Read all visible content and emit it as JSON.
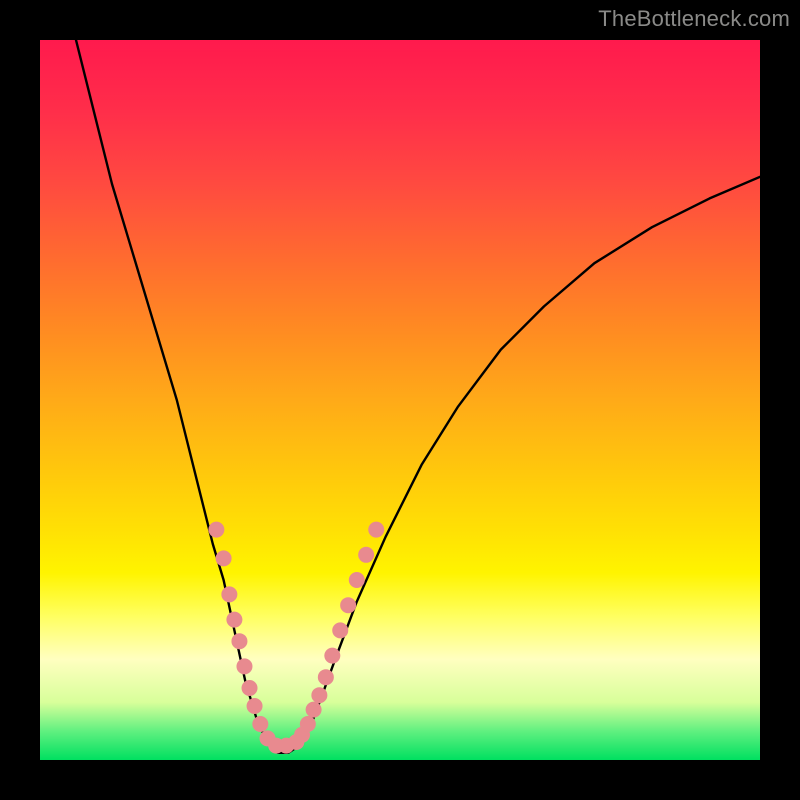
{
  "watermark": {
    "text": "TheBottleneck.com"
  },
  "chart_data": {
    "type": "line",
    "title": "",
    "xlabel": "",
    "ylabel": "",
    "xlim": [
      0,
      100
    ],
    "ylim": [
      0,
      100
    ],
    "grid": false,
    "legend": false,
    "annotations": [],
    "background": "vertical gradient red→yellow→green on black frame",
    "curve_points": [
      {
        "x": 5.0,
        "y": 100.0
      },
      {
        "x": 7.0,
        "y": 92.0
      },
      {
        "x": 10.0,
        "y": 80.0
      },
      {
        "x": 13.0,
        "y": 70.0
      },
      {
        "x": 16.0,
        "y": 60.0
      },
      {
        "x": 19.0,
        "y": 50.0
      },
      {
        "x": 22.0,
        "y": 38.0
      },
      {
        "x": 24.0,
        "y": 30.0
      },
      {
        "x": 25.5,
        "y": 25.0
      },
      {
        "x": 27.0,
        "y": 18.0
      },
      {
        "x": 28.5,
        "y": 11.0
      },
      {
        "x": 30.0,
        "y": 6.0
      },
      {
        "x": 31.5,
        "y": 2.5
      },
      {
        "x": 33.0,
        "y": 1.0
      },
      {
        "x": 34.5,
        "y": 1.0
      },
      {
        "x": 36.0,
        "y": 2.0
      },
      {
        "x": 37.5,
        "y": 4.5
      },
      {
        "x": 39.0,
        "y": 8.5
      },
      {
        "x": 41.0,
        "y": 14.0
      },
      {
        "x": 44.0,
        "y": 22.0
      },
      {
        "x": 48.0,
        "y": 31.0
      },
      {
        "x": 53.0,
        "y": 41.0
      },
      {
        "x": 58.0,
        "y": 49.0
      },
      {
        "x": 64.0,
        "y": 57.0
      },
      {
        "x": 70.0,
        "y": 63.0
      },
      {
        "x": 77.0,
        "y": 69.0
      },
      {
        "x": 85.0,
        "y": 74.0
      },
      {
        "x": 93.0,
        "y": 78.0
      },
      {
        "x": 100.0,
        "y": 81.0
      }
    ],
    "marker_points": [
      {
        "x": 24.5,
        "y": 32.0
      },
      {
        "x": 25.5,
        "y": 28.0
      },
      {
        "x": 26.3,
        "y": 23.0
      },
      {
        "x": 27.0,
        "y": 19.5
      },
      {
        "x": 27.7,
        "y": 16.5
      },
      {
        "x": 28.4,
        "y": 13.0
      },
      {
        "x": 29.1,
        "y": 10.0
      },
      {
        "x": 29.8,
        "y": 7.5
      },
      {
        "x": 30.6,
        "y": 5.0
      },
      {
        "x": 31.6,
        "y": 3.0
      },
      {
        "x": 32.8,
        "y": 2.0
      },
      {
        "x": 34.2,
        "y": 2.0
      },
      {
        "x": 35.6,
        "y": 2.5
      },
      {
        "x": 36.4,
        "y": 3.5
      },
      {
        "x": 37.2,
        "y": 5.0
      },
      {
        "x": 38.0,
        "y": 7.0
      },
      {
        "x": 38.8,
        "y": 9.0
      },
      {
        "x": 39.7,
        "y": 11.5
      },
      {
        "x": 40.6,
        "y": 14.5
      },
      {
        "x": 41.7,
        "y": 18.0
      },
      {
        "x": 42.8,
        "y": 21.5
      },
      {
        "x": 44.0,
        "y": 25.0
      },
      {
        "x": 45.3,
        "y": 28.5
      },
      {
        "x": 46.7,
        "y": 32.0
      }
    ],
    "marker_radius_px": 8
  }
}
